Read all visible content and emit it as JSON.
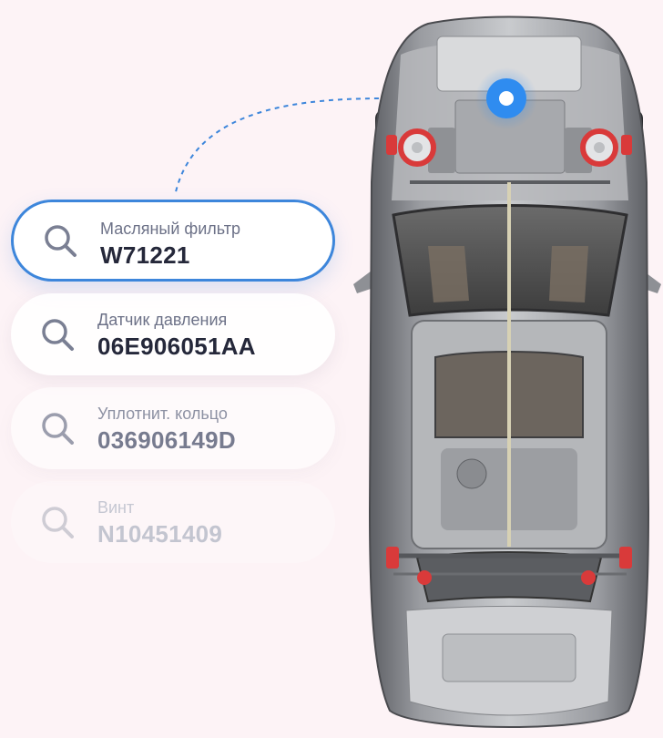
{
  "parts": [
    {
      "label": "Масляный фильтр",
      "code": "W71221",
      "icon": "search-icon"
    },
    {
      "label": "Датчик давления",
      "code": "06E906051AA",
      "icon": "search-icon"
    },
    {
      "label": "Уплотнит. кольцо",
      "code": "036906149D",
      "icon": "search-icon"
    },
    {
      "label": "Винт",
      "code": "N10451409",
      "icon": "search-icon"
    }
  ],
  "colors": {
    "background": "#fdf3f6",
    "accent": "#3d86db",
    "marker": "#2f8cf0",
    "brake": "#d93a3a"
  },
  "illustration": "car-xray-top-view"
}
